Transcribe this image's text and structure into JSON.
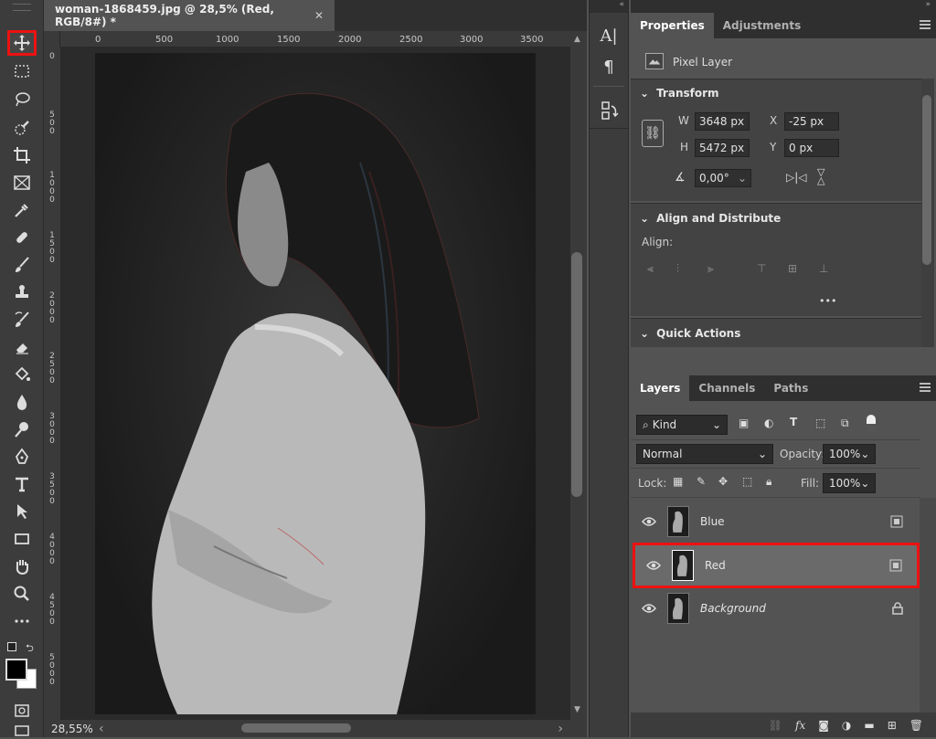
{
  "document": {
    "tab_title": "woman-1868459.jpg @ 28,5% (Red, RGB/8#) *",
    "close_glyph": "✕",
    "ruler_h": [
      "0",
      "500",
      "1000",
      "1500",
      "2000",
      "2500",
      "3000",
      "3500"
    ],
    "ruler_v": [
      "0",
      "500",
      "1000",
      "1500",
      "2000",
      "2500",
      "3000",
      "3500",
      "4000",
      "4500",
      "5000"
    ],
    "zoom": "28,55%",
    "scroll_left": "‹",
    "scroll_right": "›"
  },
  "tools": [
    "move-tool",
    "marquee-tool",
    "lasso-tool",
    "quick-selection-tool",
    "crop-tool",
    "frame-tool",
    "eyedropper-tool",
    "healing-brush-tool",
    "brush-tool",
    "clone-stamp-tool",
    "history-brush-tool",
    "eraser-tool",
    "paint-bucket-tool",
    "blur-tool",
    "dodge-tool",
    "pen-tool",
    "type-tool",
    "path-selection-tool",
    "rectangle-tool",
    "hand-tool",
    "zoom-tool",
    "more-tools"
  ],
  "properties": {
    "tabs": [
      "Properties",
      "Adjustments"
    ],
    "kind": "Pixel Layer",
    "transform": {
      "title": "Transform",
      "w_label": "W",
      "w_value": "3648 px",
      "h_label": "H",
      "h_value": "5472 px",
      "x_label": "X",
      "x_value": "-25 px",
      "y_label": "Y",
      "y_value": "0 px",
      "angle": "0,00°"
    },
    "align": {
      "title": "Align and Distribute",
      "align_label": "Align:",
      "more": "•••"
    },
    "quick_actions": {
      "title": "Quick Actions"
    }
  },
  "layers_panel": {
    "tabs": [
      "Layers",
      "Channels",
      "Paths"
    ],
    "filter_kind": "Kind",
    "blend_mode": "Normal",
    "opacity_label": "Opacity:",
    "opacity_value": "100%",
    "lock_label": "Lock:",
    "fill_label": "Fill:",
    "fill_value": "100%",
    "layers": [
      {
        "name": "Blue"
      },
      {
        "name": "Red"
      },
      {
        "name": "Background"
      }
    ],
    "fx": "fx"
  },
  "colors": {
    "accent_red": "#e11111",
    "panel_bg": "#535353",
    "dark": "#3c3c3c"
  }
}
